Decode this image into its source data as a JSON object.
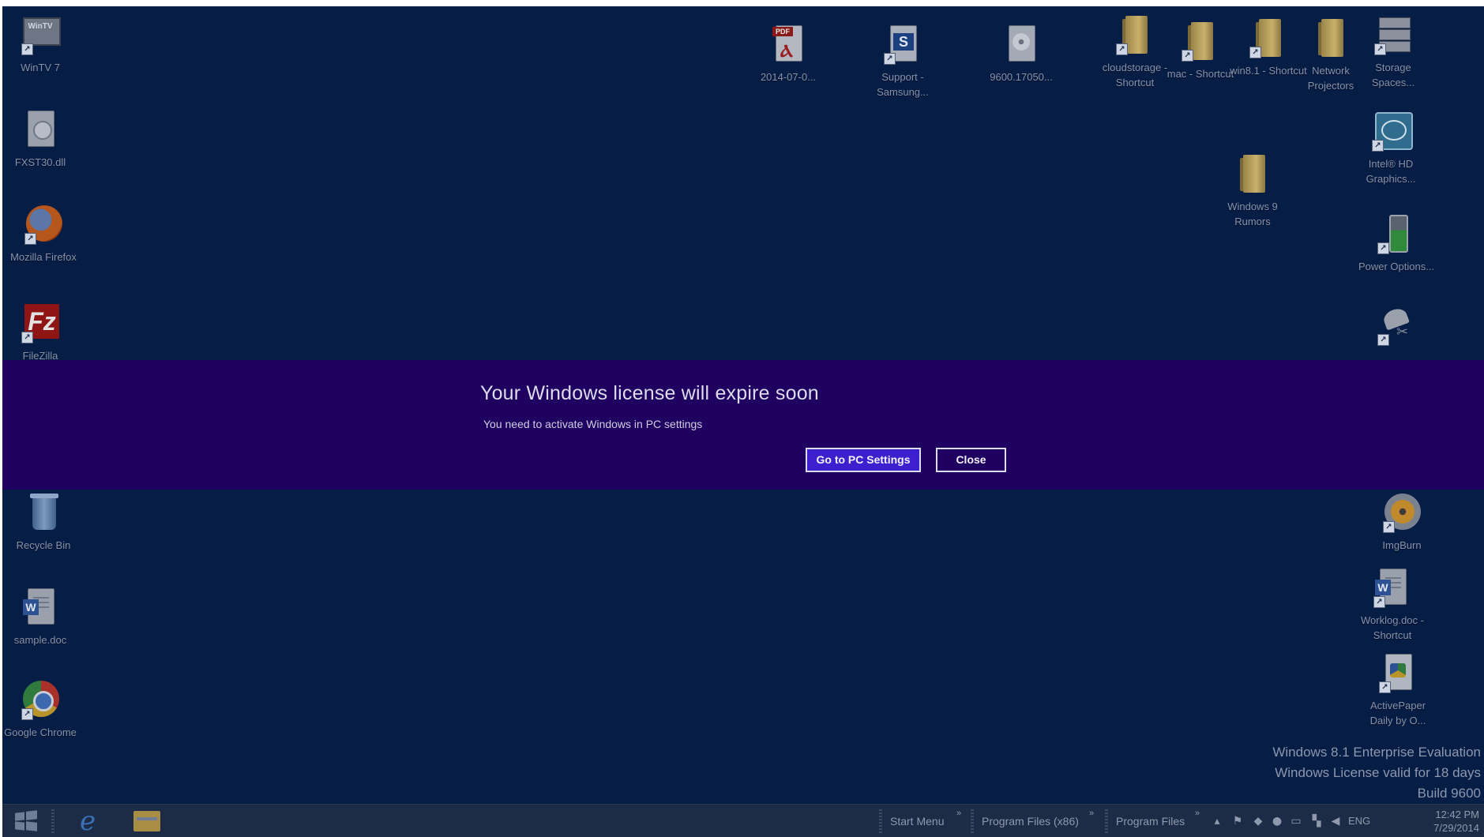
{
  "desktop": {
    "left_column": [
      {
        "label": "WinTV 7",
        "icon": "tv-icon"
      },
      {
        "label": "FXST30.dll",
        "icon": "dll-file-icon"
      },
      {
        "label": "Mozilla Firefox",
        "icon": "firefox-icon"
      },
      {
        "label": "FileZilla",
        "icon": "filezilla-icon"
      },
      {
        "label": "Recycle Bin",
        "icon": "recycle-bin-icon"
      },
      {
        "label": "sample.doc",
        "icon": "word-document-icon"
      },
      {
        "label": "Google Chrome",
        "icon": "chrome-icon"
      }
    ],
    "top_row": [
      {
        "label": "2014-07-0...",
        "icon": "pdf-icon"
      },
      {
        "label": "Support - Samsung...",
        "icon": "samsung-support-icon"
      },
      {
        "label": "9600.17050...",
        "icon": "disc-image-icon"
      },
      {
        "label": "cloudstorage - Shortcut",
        "icon": "folder-icon"
      },
      {
        "label": "mac - Shortcut",
        "icon": "folder-icon"
      },
      {
        "label": "win8.1 - Shortcut",
        "icon": "folder-icon"
      },
      {
        "label": "Network Projectors",
        "icon": "folder-icon"
      },
      {
        "label": "Storage Spaces...",
        "icon": "storage-spaces-icon"
      }
    ],
    "right_column": [
      {
        "label": "Intel® HD Graphics...",
        "icon": "intel-graphics-icon"
      },
      {
        "label": "Windows 9 Rumors",
        "icon": "folder-icon"
      },
      {
        "label": "Power Options...",
        "icon": "battery-icon"
      },
      {
        "label": "",
        "icon": "snipping-tool-icon"
      },
      {
        "label": "ImgBurn",
        "icon": "imgburn-icon"
      },
      {
        "label": "Worklog.doc - Shortcut",
        "icon": "word-document-icon"
      },
      {
        "label": "ActivePaper Daily by O...",
        "icon": "activepaper-icon"
      }
    ]
  },
  "license_band": {
    "title": "Your Windows license will expire soon",
    "message": "You need to activate Windows in PC settings",
    "primary_button": "Go to PC Settings",
    "secondary_button": "Close",
    "background_color": "#1f0060",
    "accent_color": "#3d1fd0"
  },
  "watermark": {
    "line1": "Windows 8.1 Enterprise Evaluation",
    "line2": "Windows License valid for 18 days",
    "line3": "Build 9600"
  },
  "taskbar": {
    "toolbars": [
      "Start Menu",
      "Program Files (x86)",
      "Program Files"
    ],
    "language": "ENG",
    "time": "12:42 PM",
    "date": "7/29/2014"
  }
}
